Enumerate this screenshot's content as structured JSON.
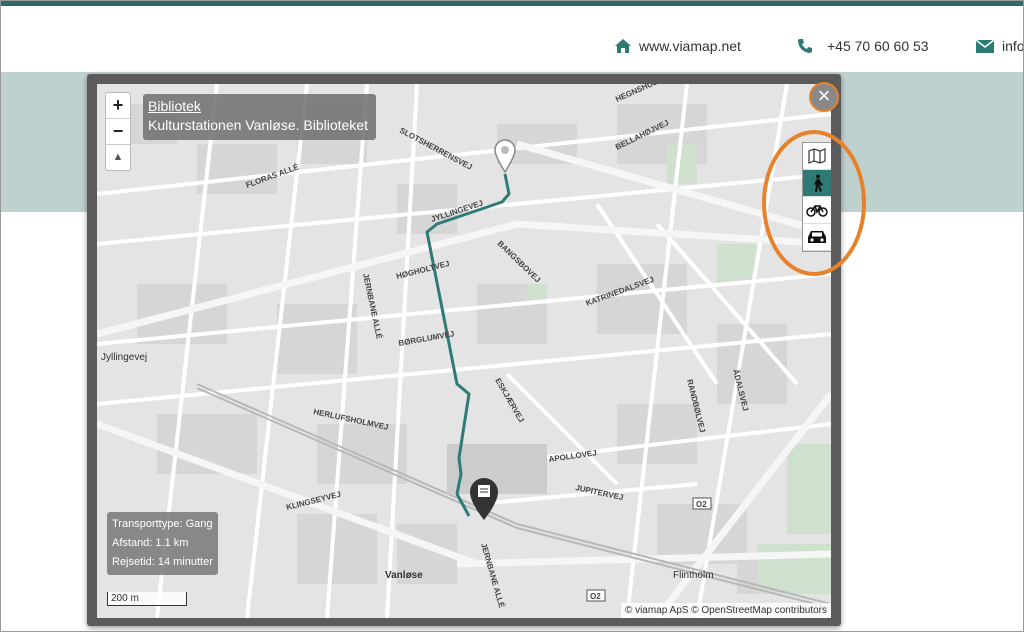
{
  "header": {
    "website": "www.viamap.net",
    "phone": "+45 70 60 60 53",
    "email": "info"
  },
  "map": {
    "destination_category": "Bibliotek",
    "destination_name": "Kulturstationen Vanløse. Biblioteket",
    "close_icon": "close-circle-icon",
    "zoom_in": "+",
    "zoom_out": "−",
    "north_arrow": "▲",
    "modes": [
      {
        "name": "map-legend-icon",
        "active": false
      },
      {
        "name": "walk-icon",
        "active": true
      },
      {
        "name": "bike-icon",
        "active": false
      },
      {
        "name": "car-icon",
        "active": false
      }
    ],
    "route_info": {
      "transport": "Transporttype: Gang",
      "distance": "Afstand: 1.1 km",
      "duration": "Rejsetid: 14 minutter"
    },
    "scale": "200 m",
    "attribution": "© viamap ApS © OpenStreetMap contributors",
    "street_labels": {
      "slotsherrensvej": "SLOTSHERRENSVEJ",
      "jyllingevej": "JYLLINGEVEJ",
      "jyllingevej_west": "Jyllingevej",
      "hoegholtvej": "HØGHOLTVEJ",
      "borglumvej": "BØRGLUMVEJ",
      "bangsbovej": "BANGSBOVEJ",
      "katrinedalsvej": "KATRINEDALSVEJ",
      "eskjaervej": "ESKJÆRVEJ",
      "apollovej": "APOLLOVEJ",
      "jupitervej": "JUPITERVEJ",
      "herlufsholmvej": "HERLUFSHOLMVEJ",
      "klingsegyvej": "KLINGSEYVEJ",
      "jernbane_alle": "JERNBANE ALLÉ",
      "jernbane_alle_s": "JERNBANE ALLÉ",
      "floras_alle": "FLORAS ALLÉ",
      "bellahoejvej": "BELLAHØJVEJ",
      "hegnshusvej": "HEGNSHUSVEJ",
      "randbolvej": "RANDBØLVEJ",
      "adalsvej": "ÅDALSVEJ",
      "vanloese": "Vanløse",
      "flintholm": "Flintholm",
      "o2_a": "O2",
      "o2_b": "O2"
    }
  }
}
